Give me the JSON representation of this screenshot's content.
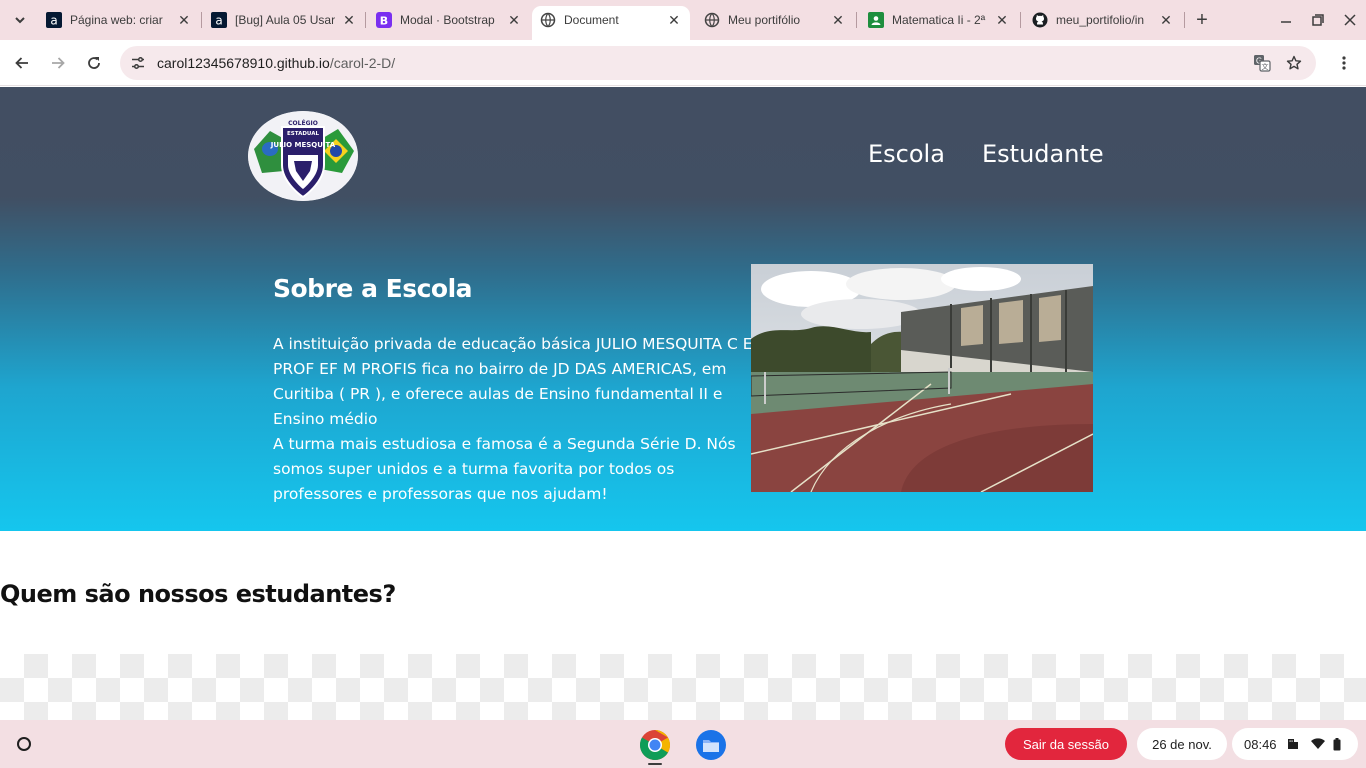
{
  "browser": {
    "tabs": [
      {
        "title": "Página web: criar",
        "favicon": "alura-icon",
        "active": false
      },
      {
        "title": "[Bug] Aula 05 Usar",
        "favicon": "alura-icon",
        "active": false
      },
      {
        "title": "Modal · Bootstrap",
        "favicon": "bootstrap-icon",
        "active": false
      },
      {
        "title": "Document",
        "favicon": "globe-icon",
        "active": true
      },
      {
        "title": "Meu portifólio",
        "favicon": "globe-icon",
        "active": false
      },
      {
        "title": "Matematica Ii - 2ª",
        "favicon": "classroom-icon",
        "active": false
      },
      {
        "title": "meu_portifolio/in",
        "favicon": "github-icon",
        "active": false
      }
    ],
    "url_host": "carol12345678910.github.io",
    "url_path": "/carol-2-D/"
  },
  "site": {
    "nav": {
      "escola": "Escola",
      "estudante": "Estudante"
    },
    "logo": {
      "line1": "COLÉGIO",
      "line2": "ESTADUAL",
      "name": "JULIO MESQUITA"
    },
    "about": {
      "title": "Sobre a Escola",
      "paragraph1": "A instituição privada de educação básica JULIO MESQUITA C E PROF EF M PROFIS fica no bairro de JD DAS AMERICAS, em Curitiba ( PR ), e oferece aulas de Ensino fundamental II e Ensino médio",
      "paragraph2": "A turma mais estudiosa e famosa é a Segunda Série D. Nós somos super unidos e a turma favorita por todos os professores e professoras que nos ajudam!"
    },
    "students_title": "Quem são nossos estudantes?"
  },
  "shelf": {
    "apps": [
      "chrome-icon",
      "files-icon"
    ],
    "logout": "Sair da sessão",
    "date": "26 de nov.",
    "time": "08:46"
  },
  "colors": {
    "accent_logout": "#e2263d",
    "hero_top": "#424e62",
    "hero_bottom": "#15c6ee"
  }
}
